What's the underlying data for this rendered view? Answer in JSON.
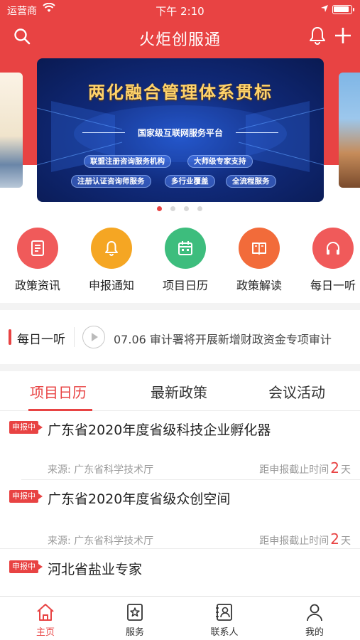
{
  "status_bar": {
    "carrier": "运营商",
    "time": "下午 2:10"
  },
  "nav": {
    "title": "火炬创服通",
    "search_icon": "search-icon",
    "bell_icon": "bell-icon",
    "plus_icon": "plus-icon"
  },
  "banner": {
    "title": "两化融合管理体系贯标",
    "subtitle": "国家级互联网服务平台",
    "pills": [
      "联盟注册咨询服务机构",
      "大师级专家支持",
      "注册认证咨询师服务",
      "多行业覆盖",
      "全流程服务"
    ],
    "slide_count": 4,
    "active_slide": 1
  },
  "shortcuts": [
    {
      "label": "政策资讯",
      "icon": "document-icon",
      "color": "#f05a5a"
    },
    {
      "label": "申报通知",
      "icon": "bell-icon",
      "color": "#f5a623"
    },
    {
      "label": "项目日历",
      "icon": "calendar-icon",
      "color": "#3dbd7d"
    },
    {
      "label": "政策解读",
      "icon": "book-icon",
      "color": "#f26b3a"
    },
    {
      "label": "每日一听",
      "icon": "headphones-icon",
      "color": "#f05a5a"
    }
  ],
  "daily": {
    "title": "每日一听",
    "text": "07.06 审计署将开展新增财政资金专项审计"
  },
  "tabs": [
    {
      "label": "项目日历",
      "active": true
    },
    {
      "label": "最新政策",
      "active": false
    },
    {
      "label": "会议活动",
      "active": false
    }
  ],
  "items": [
    {
      "badge": "申报中",
      "title": "广东省2020年度省级科技企业孵化器",
      "source": "来源: 广东省科学技术厅",
      "deadline_prefix": "距申报截止时间",
      "days": "2",
      "deadline_suffix": "天"
    },
    {
      "badge": "申报中",
      "title": "广东省2020年度省级众创空间",
      "source": "来源: 广东省科学技术厅",
      "deadline_prefix": "距申报截止时间",
      "days": "2",
      "deadline_suffix": "天"
    },
    {
      "badge": "申报中",
      "title": "河北省盐业专家"
    }
  ],
  "tabbar": [
    {
      "label": "主页",
      "icon": "home-icon",
      "active": true
    },
    {
      "label": "服务",
      "icon": "service-icon",
      "active": false
    },
    {
      "label": "联系人",
      "icon": "contacts-icon",
      "active": false
    },
    {
      "label": "我的",
      "icon": "profile-icon",
      "active": false
    }
  ],
  "colors": {
    "accent": "#e84343",
    "banner_bg": "#102a7a",
    "banner_title": "#ffd36b"
  }
}
